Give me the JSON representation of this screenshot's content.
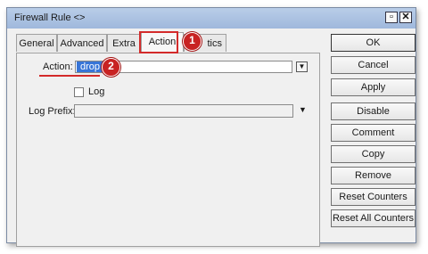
{
  "window": {
    "title": "Firewall Rule <>",
    "restore_glyph": "▫",
    "close_glyph": "✕"
  },
  "tabs": [
    {
      "label": "General"
    },
    {
      "label": "Advanced"
    },
    {
      "label": "Extra"
    },
    {
      "label": "Action"
    },
    {
      "label": "tics"
    }
  ],
  "form": {
    "action_label": "Action:",
    "action_value": "drop",
    "log_label": "Log",
    "log_prefix_label": "Log Prefix:",
    "log_prefix_value": ""
  },
  "buttons": {
    "ok": "OK",
    "cancel": "Cancel",
    "apply": "Apply",
    "disable": "Disable",
    "comment": "Comment",
    "copy": "Copy",
    "remove": "Remove",
    "reset_counters": "Reset Counters",
    "reset_all_counters": "Reset All Counters"
  },
  "annotations": {
    "step1": "1",
    "step2": "2",
    "color": "#d32a2a"
  }
}
